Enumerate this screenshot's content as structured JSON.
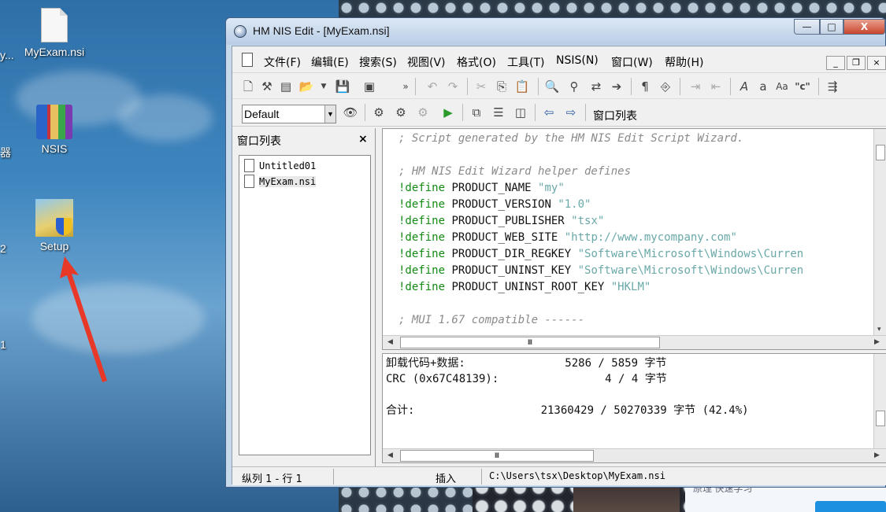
{
  "desktop": {
    "icons": [
      {
        "label": "MyExam.nsi",
        "icon": "nsi-file-icon"
      },
      {
        "label": "NSIS",
        "icon": "winrar-archive-icon"
      },
      {
        "label": "Setup",
        "icon": "setup-installer-icon"
      }
    ],
    "edge_labels": [
      "y...",
      "器",
      "2",
      "1"
    ],
    "arrow_color": "#e83828"
  },
  "window": {
    "title": "HM NIS Edit - [MyExam.nsi]",
    "controls": {
      "minimize": "—",
      "maximize": "□",
      "close": "X"
    },
    "menu": [
      "文件(F)",
      "编辑(E)",
      "搜索(S)",
      "视图(V)",
      "格式(O)",
      "工具(T)",
      "NSIS(N)",
      "窗口(W)",
      "帮助(H)"
    ],
    "toolbar2": {
      "font_select": "Default",
      "window_list_label": "窗口列表"
    },
    "left_panel": {
      "title": "窗口列表",
      "close": "×",
      "items": [
        "Untitled01",
        "MyExam.nsi"
      ]
    },
    "editor": {
      "lines": [
        [
          {
            "t": "; Script generated by the HM NIS Edit Script Wizard.",
            "c": "cm"
          }
        ],
        [],
        [
          {
            "t": "; HM NIS Edit Wizard helper defines",
            "c": "cm"
          }
        ],
        [
          {
            "t": "!define",
            "c": "kw"
          },
          {
            "t": " PRODUCT_NAME ",
            "c": "plain"
          },
          {
            "t": "\"my\"",
            "c": "str"
          }
        ],
        [
          {
            "t": "!define",
            "c": "kw"
          },
          {
            "t": " PRODUCT_VERSION ",
            "c": "plain"
          },
          {
            "t": "\"1.0\"",
            "c": "str"
          }
        ],
        [
          {
            "t": "!define",
            "c": "kw"
          },
          {
            "t": " PRODUCT_PUBLISHER ",
            "c": "plain"
          },
          {
            "t": "\"tsx\"",
            "c": "str"
          }
        ],
        [
          {
            "t": "!define",
            "c": "kw"
          },
          {
            "t": " PRODUCT_WEB_SITE ",
            "c": "plain"
          },
          {
            "t": "\"http://www.mycompany.com\"",
            "c": "str"
          }
        ],
        [
          {
            "t": "!define",
            "c": "kw"
          },
          {
            "t": " PRODUCT_DIR_REGKEY ",
            "c": "plain"
          },
          {
            "t": "\"Software\\Microsoft\\Windows\\Curren",
            "c": "str"
          }
        ],
        [
          {
            "t": "!define",
            "c": "kw"
          },
          {
            "t": " PRODUCT_UNINST_KEY ",
            "c": "plain"
          },
          {
            "t": "\"Software\\Microsoft\\Windows\\Curren",
            "c": "str"
          }
        ],
        [
          {
            "t": "!define",
            "c": "kw"
          },
          {
            "t": " PRODUCT_UNINST_ROOT_KEY ",
            "c": "plain"
          },
          {
            "t": "\"HKLM\"",
            "c": "str"
          }
        ],
        [],
        [
          {
            "t": "; MUI 1.67 compatible ------",
            "c": "cm"
          }
        ]
      ]
    },
    "output": {
      "lines": [
        "卸载代码+数据:               5286 / 5859 字节",
        "CRC (0x67C48139):                4 / 4 字节",
        "",
        "合计:                   21360429 / 50270339 字节 (42.4%)"
      ]
    },
    "status": {
      "position": "纵列 1 - 行 1",
      "mode": "插入",
      "path": "C:\\Users\\tsx\\Desktop\\MyExam.nsi"
    }
  },
  "background_ad": {
    "text": "原理  快速学习"
  }
}
